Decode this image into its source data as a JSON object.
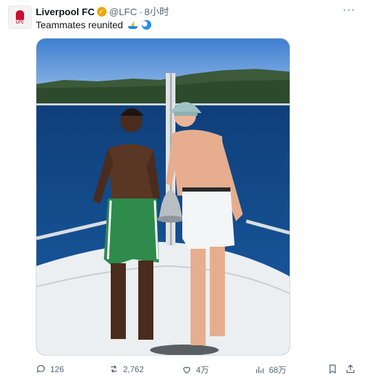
{
  "tweet": {
    "author_name": "Liverpool FC",
    "handle": "@LFC",
    "separator": "·",
    "time": "8小时",
    "text": "Teammates reunited",
    "more_label": "···",
    "avatar_text": "LFC"
  },
  "actions": {
    "replies": "126",
    "retweets": "2,762",
    "likes": "4万",
    "views": "68万"
  },
  "icons": [
    "verified-badge-icon",
    "sailboat-emoji-icon",
    "wave-emoji-icon",
    "reply-icon",
    "retweet-icon",
    "like-icon",
    "views-icon",
    "bookmark-icon",
    "share-icon"
  ],
  "colors": {
    "verified": "#e8a80c",
    "brand": "#c8102e",
    "muted": "#536471"
  }
}
